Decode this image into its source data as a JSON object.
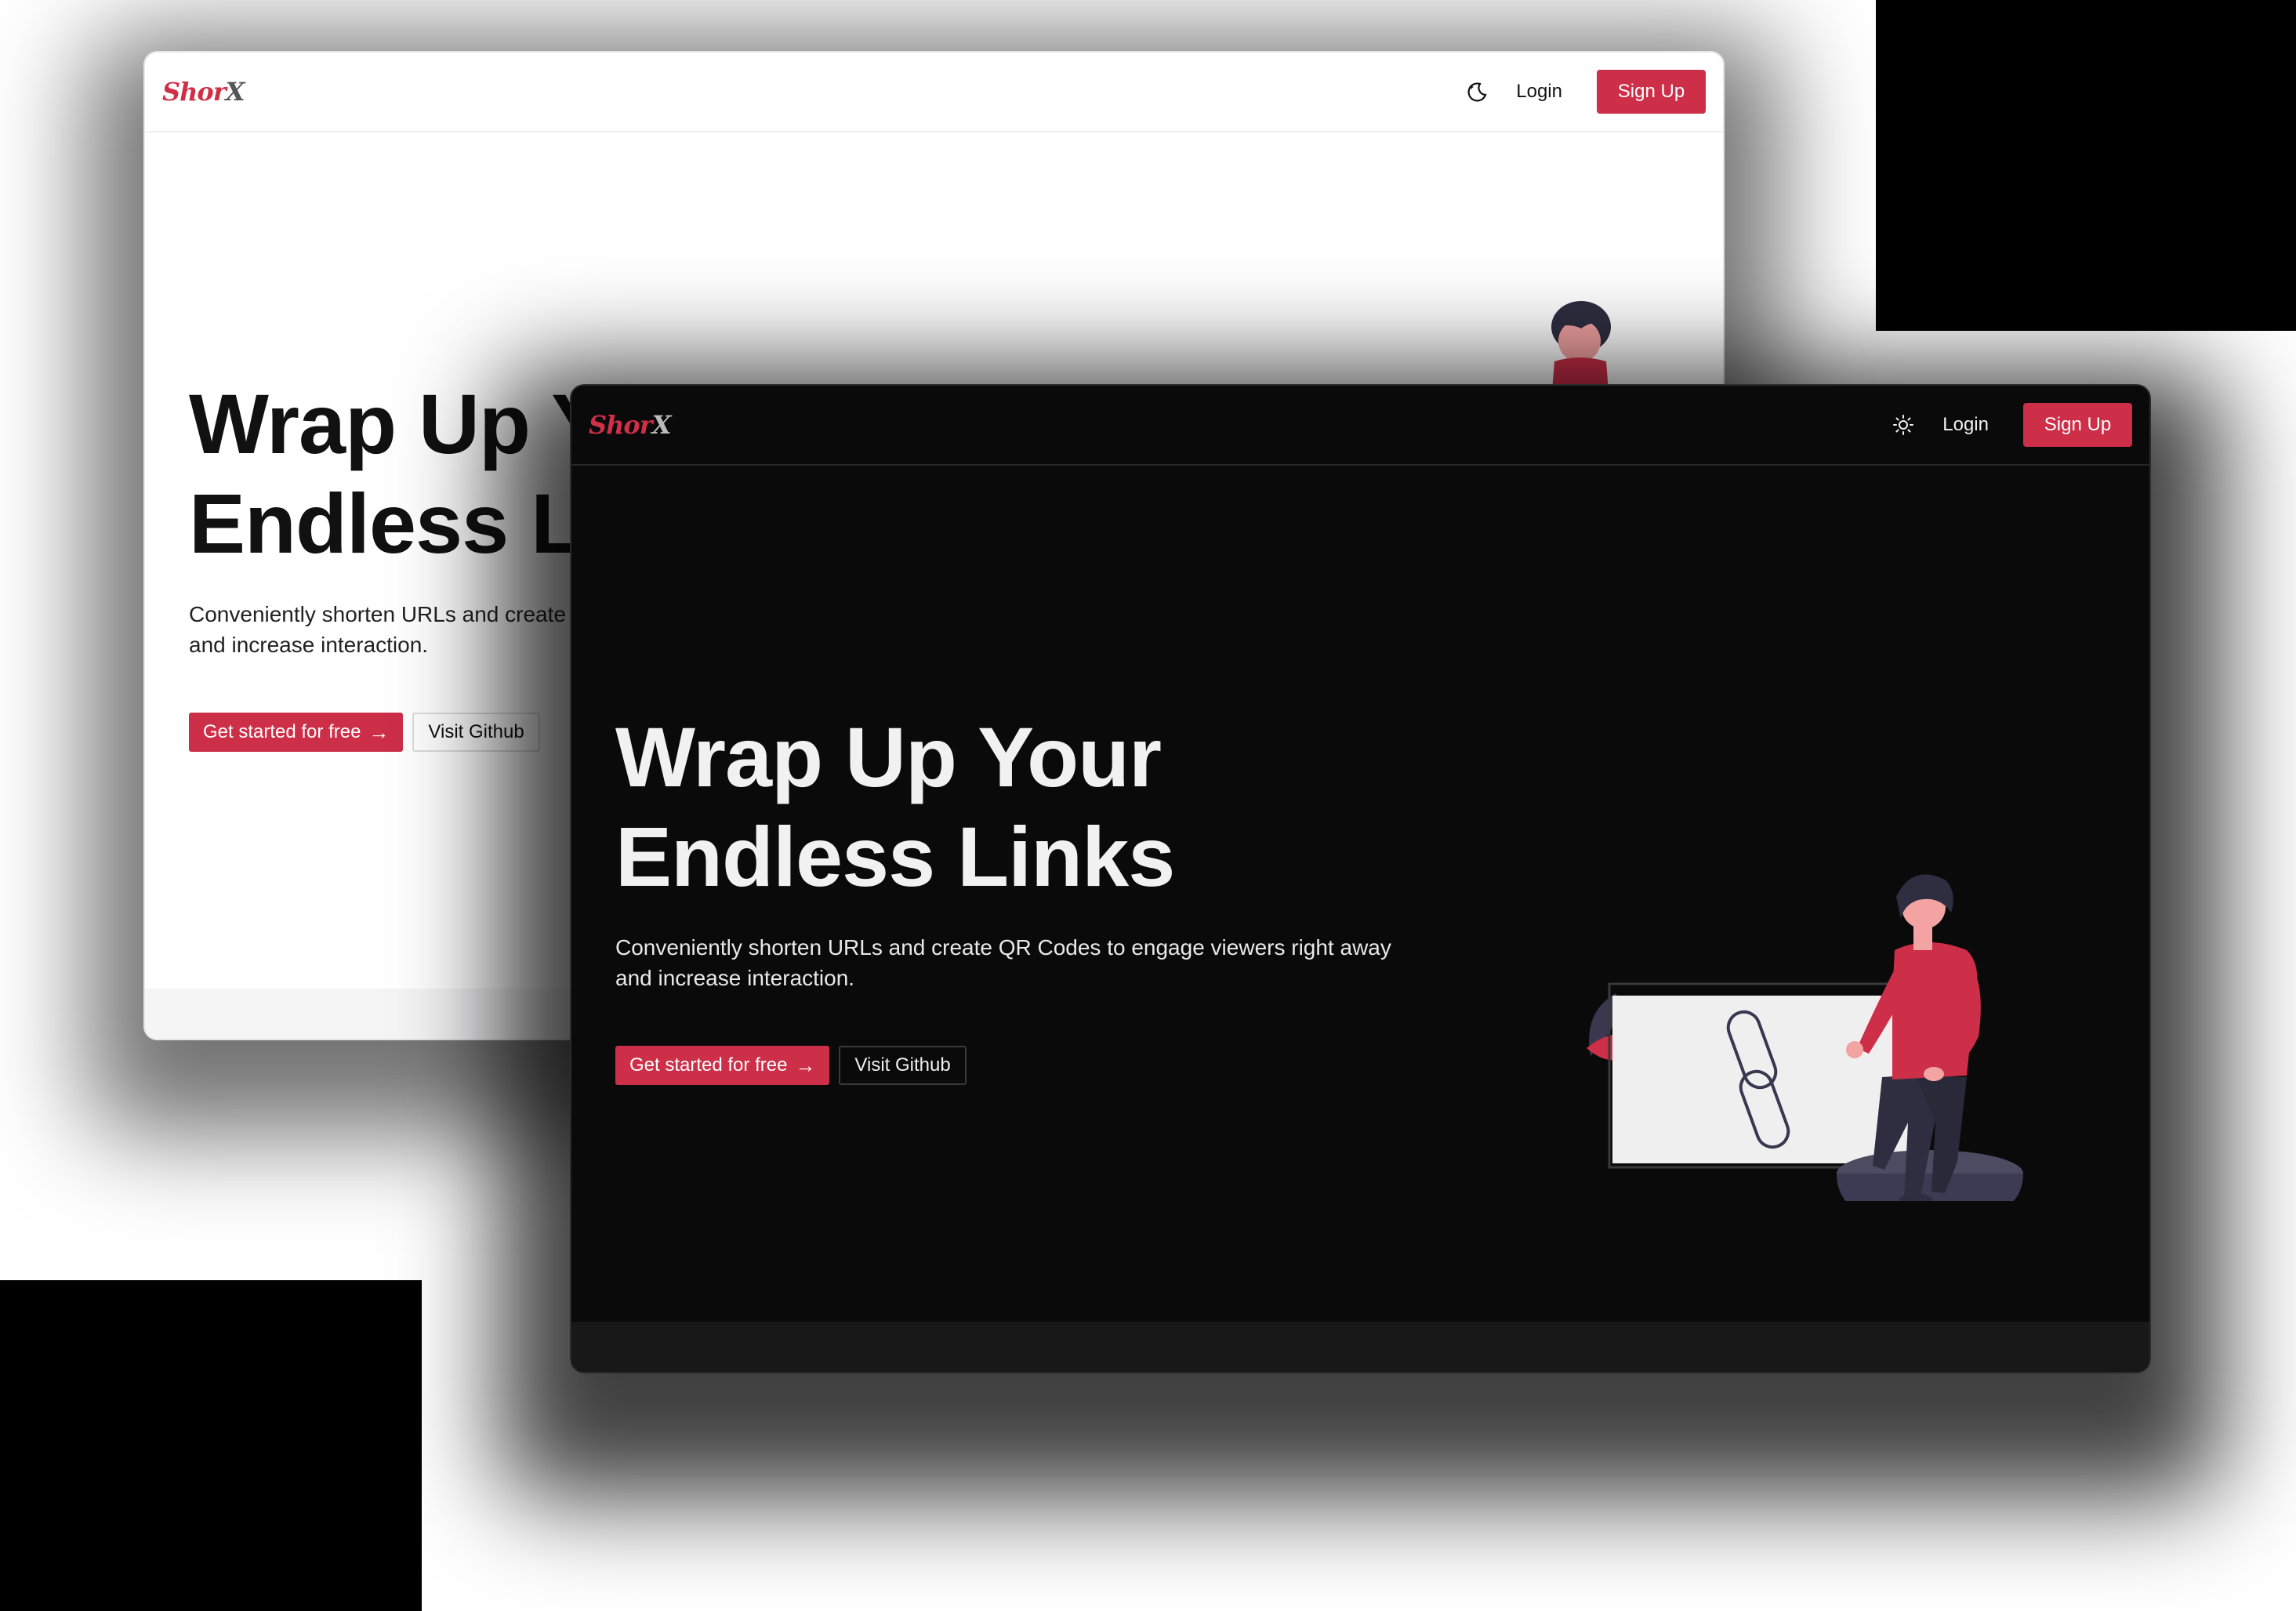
{
  "colors": {
    "brand_red": "#cd2e48",
    "light_bg": "#ffffff",
    "dark_bg": "#0b0a0a"
  },
  "light_window": {
    "logo": {
      "part1": "Shor",
      "part2": "X"
    },
    "nav": {
      "theme_icon": "moon-icon",
      "login_label": "Login",
      "signup_label": "Sign Up"
    },
    "hero": {
      "title_line1": "Wrap Up Your",
      "title_line2": "Endless Links",
      "subtitle": "Conveniently shorten URLs and create QR Codes to engage viewers right away and increase interaction.",
      "cta_primary_label": "Get started for free",
      "cta_primary_icon": "arrow-right-icon",
      "cta_secondary_label": "Visit Github"
    }
  },
  "dark_window": {
    "logo": {
      "part1": "Shor",
      "part2": "X"
    },
    "nav": {
      "theme_icon": "sun-icon",
      "login_label": "Login",
      "signup_label": "Sign Up"
    },
    "hero": {
      "title_line1": "Wrap Up Your",
      "title_line2": "Endless Links",
      "subtitle": "Conveniently shorten URLs and create QR Codes to engage viewers right away and increase interaction.",
      "cta_primary_label": "Get started for free",
      "cta_primary_icon": "arrow-right-icon",
      "cta_secondary_label": "Visit Github"
    },
    "illustration": "person-with-link-illustration"
  }
}
